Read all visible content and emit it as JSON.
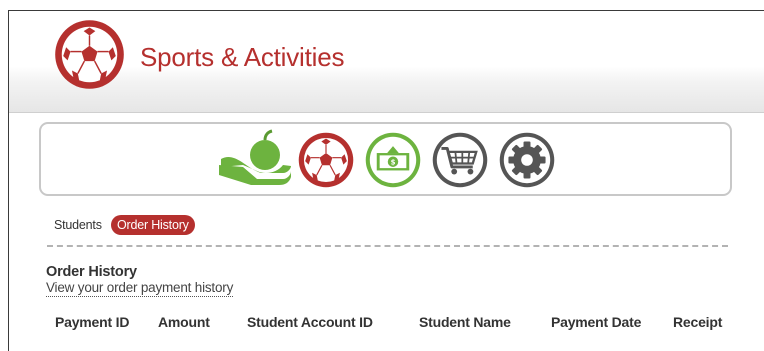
{
  "header": {
    "title": "Sports & Activities"
  },
  "tabs": [
    {
      "label": "Students",
      "active": false
    },
    {
      "label": "Order History",
      "active": true
    }
  ],
  "section": {
    "title": "Order History",
    "subtitle": "View your order payment history"
  },
  "table": {
    "columns": [
      "Payment ID",
      "Amount",
      "Student Account ID",
      "Student Name",
      "Payment Date",
      "Receipt"
    ]
  },
  "icons": [
    "apple-hand-icon",
    "soccer-ball-icon",
    "money-icon",
    "shopping-cart-icon",
    "gear-icon"
  ],
  "colors": {
    "brand_red": "#b5302e",
    "green": "#6db33f",
    "gray": "#555555"
  }
}
